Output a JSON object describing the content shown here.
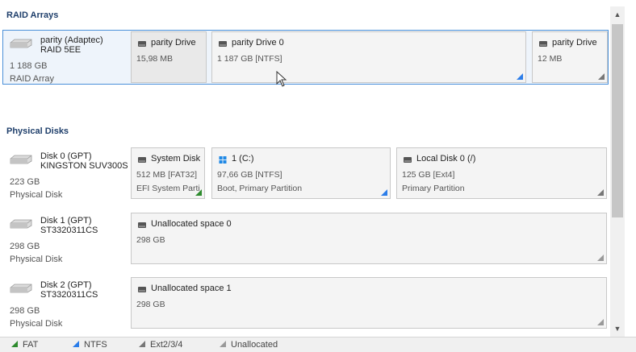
{
  "sections": {
    "raid_title": "RAID Arrays",
    "physical_title": "Physical Disks"
  },
  "raid": {
    "disk": {
      "name1": "parity (Adaptec)",
      "name2": "RAID 5EE",
      "size": "1 188 GB",
      "kind": "RAID Array"
    },
    "partitions": [
      {
        "name": "parity Drive",
        "size": "15,98 MB",
        "type": ""
      },
      {
        "name": "parity Drive 0",
        "size": "1 187 GB [NTFS]",
        "type": ""
      },
      {
        "name": "parity Drive",
        "size": "12 MB",
        "type": ""
      }
    ]
  },
  "disks": [
    {
      "name1": "Disk 0 (GPT)",
      "name2": "KINGSTON SUV300S",
      "size": "223 GB",
      "kind": "Physical Disk",
      "partitions": [
        {
          "name": "System Disk",
          "size": "512 MB [FAT32]",
          "type": "EFI System Parti"
        },
        {
          "name": "1 (C:)",
          "size": "97,66 GB [NTFS]",
          "type": "Boot, Primary Partition"
        },
        {
          "name": "Local Disk 0 (/)",
          "size": "125 GB [Ext4]",
          "type": "Primary Partition"
        }
      ]
    },
    {
      "name1": "Disk 1 (GPT)",
      "name2": "ST3320311CS",
      "size": "298 GB",
      "kind": "Physical Disk",
      "partitions": [
        {
          "name": "Unallocated space 0",
          "size": "298 GB",
          "type": ""
        }
      ]
    },
    {
      "name1": "Disk 2 (GPT)",
      "name2": "ST3320311CS",
      "size": "298 GB",
      "kind": "Physical Disk",
      "partitions": [
        {
          "name": "Unallocated space 1",
          "size": "298 GB",
          "type": ""
        }
      ]
    }
  ],
  "legend": [
    {
      "label": "FAT",
      "color": "#2e8b2e"
    },
    {
      "label": "NTFS",
      "color": "#2b7de9"
    },
    {
      "label": "Ext2/3/4",
      "color": "#777777"
    },
    {
      "label": "Unallocated",
      "color": "#999999"
    }
  ],
  "icons": {
    "disk": "hard-disk-icon",
    "drive": "drive-icon",
    "windows": "windows-icon",
    "scroll_up": "chevron-up-icon",
    "scroll_down": "chevron-down-icon"
  }
}
